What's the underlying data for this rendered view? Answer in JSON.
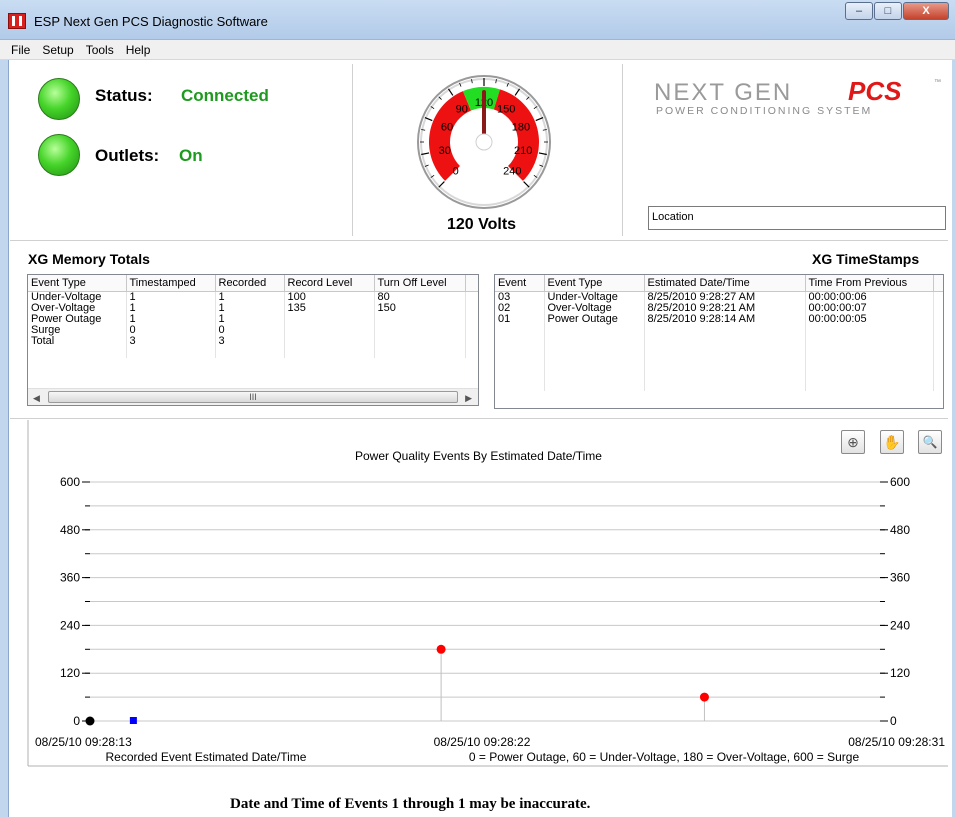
{
  "window": {
    "title": "ESP Next Gen PCS Diagnostic Software",
    "minimize_glyph": "–",
    "maximize_glyph": "□",
    "close_glyph": "X"
  },
  "menu": [
    "File",
    "Setup",
    "Tools",
    "Help"
  ],
  "status": {
    "status_label": "Status:",
    "status_value": "Connected",
    "outlets_label": "Outlets:",
    "outlets_value": "On"
  },
  "gauge": {
    "value": 120,
    "ticks": [
      "0",
      "30",
      "60",
      "90",
      "120",
      "150",
      "180",
      "210",
      "240"
    ],
    "label": "120  Volts"
  },
  "logo": {
    "line1_a": "NEXT GEN ",
    "line1_b": "PCS",
    "tm": "™",
    "line2": "POWER CONDITIONING SYSTEM"
  },
  "location": {
    "value": "Location"
  },
  "memory_totals": {
    "title": "XG Memory Totals",
    "columns": [
      "Event Type",
      "Timestamped",
      "Recorded",
      "Record Level",
      "Turn Off Level"
    ],
    "rows": [
      [
        "Under-Voltage",
        "1",
        "1",
        "100",
        "80"
      ],
      [
        "Over-Voltage",
        "1",
        "1",
        "135",
        "150"
      ],
      [
        "Power Outage",
        "1",
        "1",
        "",
        ""
      ],
      [
        "Surge",
        "0",
        "0",
        "",
        ""
      ],
      [
        "Total",
        "3",
        "3",
        "",
        ""
      ]
    ],
    "scroll_grip": "III"
  },
  "timestamps": {
    "title": "XG TimeStamps",
    "columns": [
      "Event",
      "Event Type",
      "Estimated Date/Time",
      "Time From Previous"
    ],
    "rows": [
      [
        "03",
        "Under-Voltage",
        "8/25/2010 9:28:27 AM",
        "00:00:00:06"
      ],
      [
        "02",
        "Over-Voltage",
        "8/25/2010 9:28:21 AM",
        "00:00:00:07"
      ],
      [
        "01",
        "Power Outage",
        "8/25/2010 9:28:14 AM",
        "00:00:00:05"
      ]
    ]
  },
  "chart_tools": {
    "crosshair_glyph": "⊕",
    "pan_glyph": "✋",
    "zoom_glyph": "🔍"
  },
  "chart_data": {
    "type": "scatter",
    "title": "Power Quality Events By Estimated Date/Time",
    "xlabel": "Recorded Event Estimated Date/Time",
    "legend_note": "0 = Power Outage, 60 = Under-Voltage, 180 = Over-Voltage, 600 = Surge",
    "x_tick_labels": [
      "08/25/10 09:28:13",
      "08/25/10 09:28:22",
      "08/25/10 09:28:31"
    ],
    "xlim": [
      "08/25/10 09:28:13",
      "08/25/10 09:28:31"
    ],
    "ylim": [
      0,
      600
    ],
    "y_ticks": [
      0,
      120,
      240,
      360,
      480,
      600
    ],
    "points": [
      {
        "x": "08/25/10 09:28:13",
        "y": 0,
        "color": "#000000",
        "marker": "circle"
      },
      {
        "x": "08/25/10 09:28:14",
        "y": 0,
        "color": "#0000ff",
        "marker": "square"
      },
      {
        "x": "08/25/10 09:28:21",
        "y": 180,
        "color": "#ff0000",
        "marker": "circle"
      },
      {
        "x": "08/25/10 09:28:27",
        "y": 60,
        "color": "#ff0000",
        "marker": "circle"
      }
    ]
  },
  "footer": {
    "note": "Date and Time of Events 1 through 1 may be inaccurate."
  }
}
